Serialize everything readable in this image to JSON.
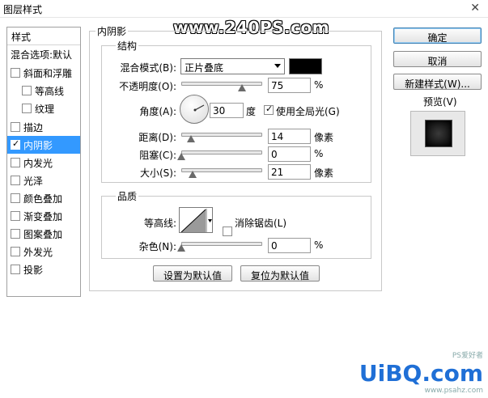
{
  "window": {
    "title": "图层样式",
    "close_symbol": "✕"
  },
  "watermark_top": "www.240PS.com",
  "sidebar": {
    "header": "样式",
    "items": [
      {
        "label": "混合选项:默认",
        "has_checkbox": false,
        "checked": false,
        "sub": false,
        "active": false
      },
      {
        "label": "斜面和浮雕",
        "has_checkbox": true,
        "checked": false,
        "sub": false,
        "active": false
      },
      {
        "label": "等高线",
        "has_checkbox": true,
        "checked": false,
        "sub": true,
        "active": false
      },
      {
        "label": "纹理",
        "has_checkbox": true,
        "checked": false,
        "sub": true,
        "active": false
      },
      {
        "label": "描边",
        "has_checkbox": true,
        "checked": false,
        "sub": false,
        "active": false
      },
      {
        "label": "内阴影",
        "has_checkbox": true,
        "checked": true,
        "sub": false,
        "active": true
      },
      {
        "label": "内发光",
        "has_checkbox": true,
        "checked": false,
        "sub": false,
        "active": false
      },
      {
        "label": "光泽",
        "has_checkbox": true,
        "checked": false,
        "sub": false,
        "active": false
      },
      {
        "label": "颜色叠加",
        "has_checkbox": true,
        "checked": false,
        "sub": false,
        "active": false
      },
      {
        "label": "渐变叠加",
        "has_checkbox": true,
        "checked": false,
        "sub": false,
        "active": false
      },
      {
        "label": "图案叠加",
        "has_checkbox": true,
        "checked": false,
        "sub": false,
        "active": false
      },
      {
        "label": "外发光",
        "has_checkbox": true,
        "checked": false,
        "sub": false,
        "active": false
      },
      {
        "label": "投影",
        "has_checkbox": true,
        "checked": false,
        "sub": false,
        "active": false
      }
    ]
  },
  "inner_shadow": {
    "group_title": "内阴影",
    "structure": {
      "title": "结构",
      "blend_mode_label": "混合模式(B):",
      "blend_mode_value": "正片叠底",
      "shadow_color": "#000000",
      "opacity_label": "不透明度(O):",
      "opacity_value": "75",
      "opacity_unit": "%",
      "angle_label": "角度(A):",
      "angle_value": "30",
      "angle_unit": "度",
      "global_light_label": "使用全局光(G)",
      "global_light_checked": true,
      "distance_label": "距离(D):",
      "distance_value": "14",
      "distance_unit": "像素",
      "choke_label": "阻塞(C):",
      "choke_value": "0",
      "choke_unit": "%",
      "size_label": "大小(S):",
      "size_value": "21",
      "size_unit": "像素"
    },
    "quality": {
      "title": "品质",
      "contour_label": "等高线:",
      "antialias_label": "消除锯齿(L)",
      "antialias_checked": false,
      "noise_label": "杂色(N):",
      "noise_value": "0",
      "noise_unit": "%"
    },
    "set_default_label": "设置为默认值",
    "reset_default_label": "复位为默认值"
  },
  "actions": {
    "ok_label": "确定",
    "cancel_label": "取消",
    "new_style_label": "新建样式(W)...",
    "preview_label": "预览(V)",
    "preview_checked": true
  },
  "watermark_bottom": {
    "brand": "UiBQ.com",
    "site": "PS爱好者",
    "url": "www.psahz.com"
  }
}
